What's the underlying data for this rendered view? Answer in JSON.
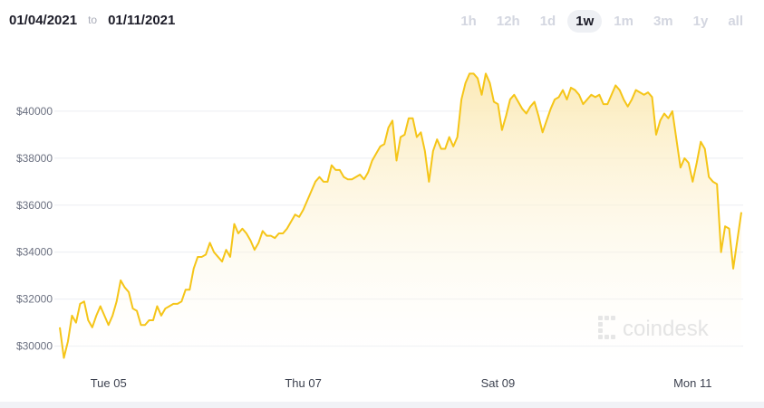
{
  "range": {
    "from": "01/04/2021",
    "to_label": "to",
    "to": "01/11/2021"
  },
  "periods": [
    "1h",
    "12h",
    "1d",
    "1w",
    "1m",
    "3m",
    "1y",
    "all"
  ],
  "active_period": "1w",
  "watermark": "coindesk",
  "colors": {
    "line": "#f5c518",
    "fill_top": "#fbe8b0",
    "grid": "#ebedf2"
  },
  "chart_data": {
    "type": "area",
    "title": "",
    "xlabel": "",
    "ylabel": "",
    "ylim": [
      29100,
      42500
    ],
    "yticks": [
      30000,
      32000,
      34000,
      36000,
      38000,
      40000
    ],
    "ytick_labels": [
      "$30000",
      "$32000",
      "$34000",
      "$36000",
      "$38000",
      "$40000"
    ],
    "xticks": [
      {
        "label": "Tue 05",
        "x": 12
      },
      {
        "label": "Thu 07",
        "x": 60
      },
      {
        "label": "Sat 09",
        "x": 108
      },
      {
        "label": "Mon 11",
        "x": 156
      }
    ],
    "x_unit": "hours since 01/04/2021 12:00",
    "grid": true,
    "series": [
      {
        "name": "",
        "x": [
          0,
          1,
          2,
          3,
          4,
          5,
          6,
          7,
          8,
          9,
          10,
          11,
          12,
          13,
          14,
          15,
          16,
          17,
          18,
          19,
          20,
          21,
          22,
          23,
          24,
          25,
          26,
          27,
          28,
          29,
          30,
          31,
          32,
          33,
          34,
          35,
          36,
          37,
          38,
          39,
          40,
          41,
          42,
          43,
          44,
          45,
          46,
          47,
          48,
          49,
          50,
          51,
          52,
          53,
          54,
          55,
          56,
          57,
          58,
          59,
          60,
          61,
          62,
          63,
          64,
          65,
          66,
          67,
          68,
          69,
          70,
          71,
          72,
          73,
          74,
          75,
          76,
          77,
          78,
          79,
          80,
          81,
          82,
          83,
          84,
          85,
          86,
          87,
          88,
          89,
          90,
          91,
          92,
          93,
          94,
          95,
          96,
          97,
          98,
          99,
          100,
          101,
          102,
          103,
          104,
          105,
          106,
          107,
          108,
          109,
          110,
          111,
          112,
          113,
          114,
          115,
          116,
          117,
          118,
          119,
          120,
          121,
          122,
          123,
          124,
          125,
          126,
          127,
          128,
          129,
          130,
          131,
          132,
          133,
          134,
          135,
          136,
          137,
          138,
          139,
          140,
          141,
          142,
          143,
          144,
          145,
          146,
          147,
          148,
          149,
          150,
          151,
          152,
          153,
          154,
          155,
          156,
          157,
          158,
          159,
          160,
          161,
          162,
          163,
          164,
          165,
          166,
          167,
          168
        ],
        "values": [
          30800,
          29500,
          30200,
          31300,
          31000,
          31800,
          31900,
          31100,
          30800,
          31300,
          31700,
          31300,
          30900,
          31300,
          31900,
          32800,
          32500,
          32300,
          31600,
          31500,
          30900,
          30900,
          31100,
          31100,
          31700,
          31300,
          31600,
          31700,
          31800,
          31800,
          31900,
          32400,
          32400,
          33300,
          33800,
          33800,
          33900,
          34400,
          34000,
          33800,
          33600,
          34100,
          33800,
          35200,
          34800,
          35000,
          34800,
          34500,
          34100,
          34400,
          34900,
          34700,
          34700,
          34600,
          34800,
          34800,
          35000,
          35300,
          35600,
          35500,
          35800,
          36200,
          36600,
          37000,
          37200,
          37000,
          37000,
          37700,
          37500,
          37500,
          37200,
          37100,
          37100,
          37200,
          37300,
          37100,
          37400,
          37900,
          38200,
          38500,
          38600,
          39300,
          39600,
          37900,
          38900,
          39000,
          39700,
          39700,
          38900,
          39100,
          38300,
          37000,
          38300,
          38800,
          38400,
          38400,
          38900,
          38500,
          38900,
          40500,
          41200,
          41600,
          41600,
          41400,
          40700,
          41600,
          41200,
          40400,
          40300,
          39200,
          39800,
          40500,
          40700,
          40400,
          40100,
          39900,
          40200,
          40400,
          39800,
          39100,
          39600,
          40100,
          40500,
          40600,
          40900,
          40500,
          41000,
          40900,
          40700,
          40300,
          40500,
          40700,
          40600,
          40700,
          40300,
          40300,
          40700,
          41100,
          40900,
          40500,
          40200,
          40500,
          40900,
          40800,
          40700,
          40800,
          40600,
          39000,
          39600,
          39900,
          39700,
          40000,
          38800,
          37600,
          38000,
          37800,
          37000,
          37800,
          38700,
          38400,
          37200,
          37000,
          36900,
          34000,
          35100,
          35000,
          33300,
          34500,
          35700
        ]
      }
    ]
  }
}
